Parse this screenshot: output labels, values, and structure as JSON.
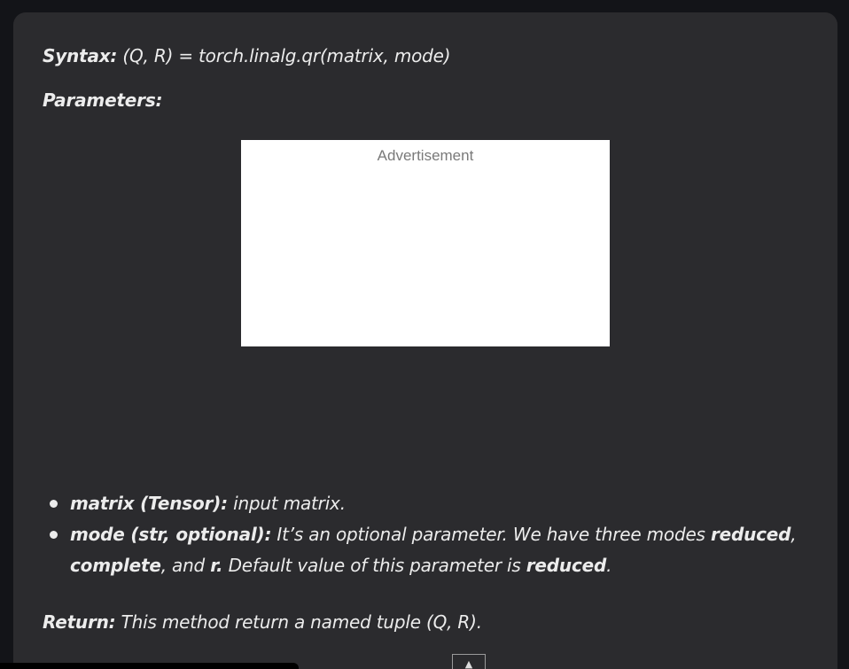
{
  "syntax": {
    "label": "Syntax:",
    "text": " (Q, R) = torch.linalg.qr(matrix, mode)"
  },
  "parameters": {
    "label": "Parameters:"
  },
  "advertisement": {
    "label": "Advertisement"
  },
  "params": [
    {
      "name": "matrix (Tensor):",
      "desc": " input matrix."
    },
    {
      "name": "mode (str, optional):",
      "desc_before": " It’s an optional parameter. We have three modes ",
      "mode1": "reduced",
      "sep1": ", ",
      "mode2": "complete",
      "sep2": ", and ",
      "mode3": "r.",
      "desc_mid": " Default value of this parameter is ",
      "default": "reduced",
      "end": "."
    }
  ],
  "return": {
    "label": "Return:",
    "text": " This method return a named tuple (Q, R)."
  },
  "scroll_top": {
    "icon": "▲"
  },
  "colors": {
    "page_bg": "#131418",
    "card_bg": "#2b2b2e",
    "text": "#ececec",
    "ad_bg": "#ffffff"
  }
}
